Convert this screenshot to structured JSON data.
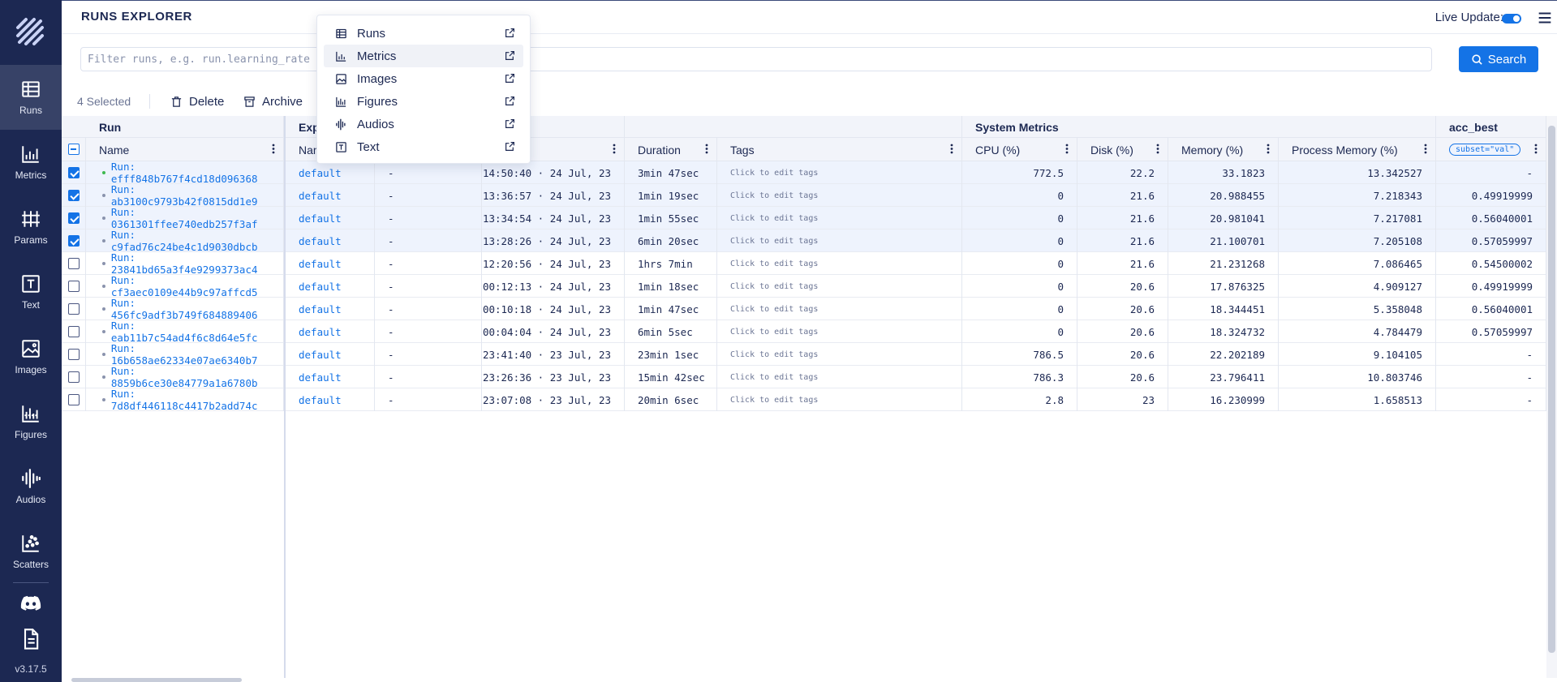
{
  "app": {
    "version": "v3.17.5"
  },
  "sidebar": {
    "items": [
      {
        "label": "Runs",
        "icon": "table-icon",
        "active": true
      },
      {
        "label": "Metrics",
        "icon": "line-chart-icon"
      },
      {
        "label": "Params",
        "icon": "params-icon"
      },
      {
        "label": "Text",
        "icon": "text-icon"
      },
      {
        "label": "Images",
        "icon": "image-icon"
      },
      {
        "label": "Figures",
        "icon": "figures-icon"
      },
      {
        "label": "Audios",
        "icon": "audio-icon"
      },
      {
        "label": "Scatters",
        "icon": "scatter-icon"
      }
    ]
  },
  "header": {
    "title": "RUNS EXPLORER",
    "live_update_label": "Live Update:",
    "live_update_on": true
  },
  "search": {
    "placeholder": "Filter runs, e.g. run.learning_rate > 0.0001 and run.batch_size == 32",
    "button_label": "Search"
  },
  "actions": {
    "selected_count": "4 Selected",
    "delete_label": "Delete",
    "archive_label": "Archive"
  },
  "dropdown": {
    "items": [
      {
        "label": "Runs",
        "icon": "table-icon"
      },
      {
        "label": "Metrics",
        "icon": "line-chart-icon",
        "hovered": true
      },
      {
        "label": "Images",
        "icon": "image-icon"
      },
      {
        "label": "Figures",
        "icon": "figures-icon"
      },
      {
        "label": "Audios",
        "icon": "audio-icon"
      },
      {
        "label": "Text",
        "icon": "text-icon"
      }
    ]
  },
  "table": {
    "groups": {
      "run": "Run",
      "experiment": "Exp",
      "system_metrics": "System Metrics",
      "acc_best": "acc_best"
    },
    "columns": {
      "name": "Name",
      "exp_name": "Nam",
      "duration": "Duration",
      "tags": "Tags",
      "cpu": "CPU (%)",
      "disk": "Disk (%)",
      "memory": "Memory (%)",
      "process_memory": "Process Memory (%)",
      "subset": "subset=\"val\""
    },
    "rows": [
      {
        "run": "Run: efff848b767f4cd18d096368",
        "exp": "default",
        "desc": "-",
        "date": "14:50:40 · 24 Jul, 23",
        "duration": "3min 47sec",
        "tags": "Click to edit tags",
        "cpu": "772.5",
        "disk": "22.2",
        "memory": "33.1823",
        "pmem": "13.342527",
        "acc": "-",
        "selected": true,
        "active": true
      },
      {
        "run": "Run: ab3100c9793b42f0815dd1e9",
        "exp": "default",
        "desc": "-",
        "date": "13:36:57 · 24 Jul, 23",
        "duration": "1min 19sec",
        "tags": "Click to edit tags",
        "cpu": "0",
        "disk": "21.6",
        "memory": "20.988455",
        "pmem": "7.218343",
        "acc": "0.49919999",
        "selected": true
      },
      {
        "run": "Run: 0361301ffee740edb257f3af",
        "exp": "default",
        "desc": "-",
        "date": "13:34:54 · 24 Jul, 23",
        "duration": "1min 55sec",
        "tags": "Click to edit tags",
        "cpu": "0",
        "disk": "21.6",
        "memory": "20.981041",
        "pmem": "7.217081",
        "acc": "0.56040001",
        "selected": true
      },
      {
        "run": "Run: c9fad76c24be4c1d9030dbcb",
        "exp": "default",
        "desc": "-",
        "date": "13:28:26 · 24 Jul, 23",
        "duration": "6min 20sec",
        "tags": "Click to edit tags",
        "cpu": "0",
        "disk": "21.6",
        "memory": "21.100701",
        "pmem": "7.205108",
        "acc": "0.57059997",
        "selected": true
      },
      {
        "run": "Run: 23841bd65a3f4e9299373ac4",
        "exp": "default",
        "desc": "-",
        "date": "12:20:56 · 24 Jul, 23",
        "duration": "1hrs 7min",
        "tags": "Click to edit tags",
        "cpu": "0",
        "disk": "21.6",
        "memory": "21.231268",
        "pmem": "7.086465",
        "acc": "0.54500002"
      },
      {
        "run": "Run: cf3aec0109e44b9c97affcd5",
        "exp": "default",
        "desc": "-",
        "date": "00:12:13 · 24 Jul, 23",
        "duration": "1min 18sec",
        "tags": "Click to edit tags",
        "cpu": "0",
        "disk": "20.6",
        "memory": "17.876325",
        "pmem": "4.909127",
        "acc": "0.49919999"
      },
      {
        "run": "Run: 456fc9adf3b749f684889406",
        "exp": "default",
        "desc": "-",
        "date": "00:10:18 · 24 Jul, 23",
        "duration": "1min 47sec",
        "tags": "Click to edit tags",
        "cpu": "0",
        "disk": "20.6",
        "memory": "18.344451",
        "pmem": "5.358048",
        "acc": "0.56040001"
      },
      {
        "run": "Run: eab11b7c54ad4f6c8d64e5fc",
        "exp": "default",
        "desc": "-",
        "date": "00:04:04 · 24 Jul, 23",
        "duration": "6min 5sec",
        "tags": "Click to edit tags",
        "cpu": "0",
        "disk": "20.6",
        "memory": "18.324732",
        "pmem": "4.784479",
        "acc": "0.57059997"
      },
      {
        "run": "Run: 16b658ae62334e07ae6340b7",
        "exp": "default",
        "desc": "-",
        "date": "23:41:40 · 23 Jul, 23",
        "duration": "23min 1sec",
        "tags": "Click to edit tags",
        "cpu": "786.5",
        "disk": "20.6",
        "memory": "22.202189",
        "pmem": "9.104105",
        "acc": "-"
      },
      {
        "run": "Run: 8859b6ce30e84779a1a6780b",
        "exp": "default",
        "desc": "-",
        "date": "23:26:36 · 23 Jul, 23",
        "duration": "15min 42sec",
        "tags": "Click to edit tags",
        "cpu": "786.3",
        "disk": "20.6",
        "memory": "23.796411",
        "pmem": "10.803746",
        "acc": "-"
      },
      {
        "run": "Run: 7d8df446118c4417b2add74c",
        "exp": "default",
        "desc": "-",
        "date": "23:07:08 · 23 Jul, 23",
        "duration": "20min 6sec",
        "tags": "Click to edit tags",
        "cpu": "2.8",
        "disk": "23",
        "memory": "16.230999",
        "pmem": "1.658513",
        "acc": "-"
      }
    ]
  },
  "colors": {
    "sidebar_bg": "#1c2852",
    "accent": "#1473e6",
    "text": "#1c2852",
    "selected_row_bg": "#eef3fd"
  }
}
